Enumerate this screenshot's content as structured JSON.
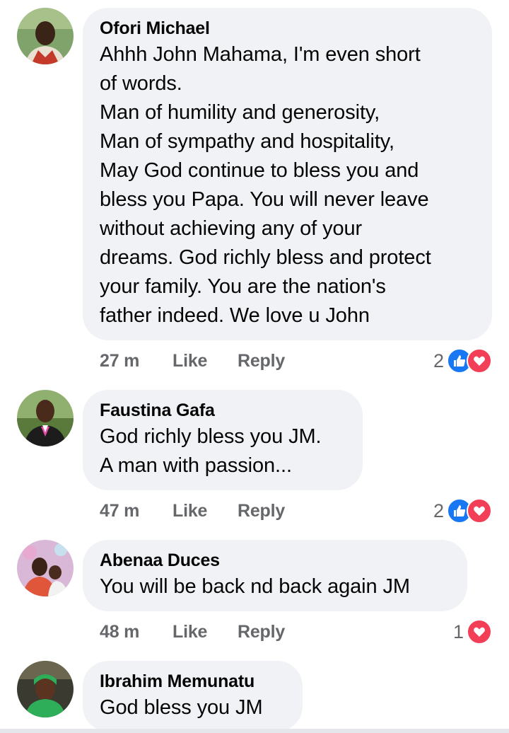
{
  "comments": [
    {
      "author": "Ofori Michael",
      "text": "Ahhh John Mahama, I'm even short\nof words.\nMan of humility and generosity,\nMan of sympathy and hospitality,\nMay God continue to bless you and\nbless you Papa. You will never leave\nwithout achieving any of your\ndreams. God richly bless and protect\nyour family. You are the nation's\nfather indeed. We love u John",
      "time": "27 m",
      "like_label": "Like",
      "reply_label": "Reply",
      "reaction_count": "2",
      "reactions": [
        "like-icon",
        "love-icon"
      ]
    },
    {
      "author": "Faustina Gafa",
      "text": "God richly bless you JM.\nA man with passion...",
      "time": "47 m",
      "like_label": "Like",
      "reply_label": "Reply",
      "reaction_count": "2",
      "reactions": [
        "like-icon",
        "love-icon"
      ]
    },
    {
      "author": "Abenaa Duces",
      "text": "You will be back nd back again JM",
      "time": "48 m",
      "like_label": "Like",
      "reply_label": "Reply",
      "reaction_count": "1",
      "reactions": [
        "love-icon"
      ]
    },
    {
      "author": "Ibrahim Memunatu",
      "text": "God bless you JM"
    }
  ],
  "colors": {
    "bubble": "#f0f2f5",
    "secondary_text": "#65676b",
    "like_blue": "#1877f2",
    "love_red": "#f33e58"
  }
}
